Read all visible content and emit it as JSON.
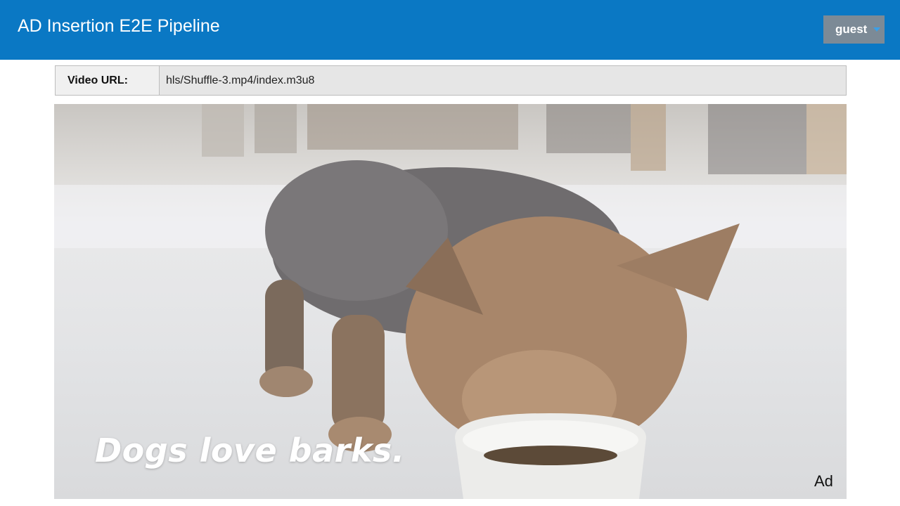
{
  "header": {
    "title": "AD Insertion E2E Pipeline",
    "user_label": "guest"
  },
  "url_bar": {
    "label": "Video URL:",
    "value": "hls/Shuffle-3.mp4/index.m3u8"
  },
  "player": {
    "caption": "Dogs love barks.",
    "ad_badge": "Ad",
    "icon": "video-frame-dog-eating"
  },
  "colors": {
    "header_bg": "#0a78c4",
    "user_button_bg": "#7c8a96",
    "caret": "#3aa0e8"
  }
}
